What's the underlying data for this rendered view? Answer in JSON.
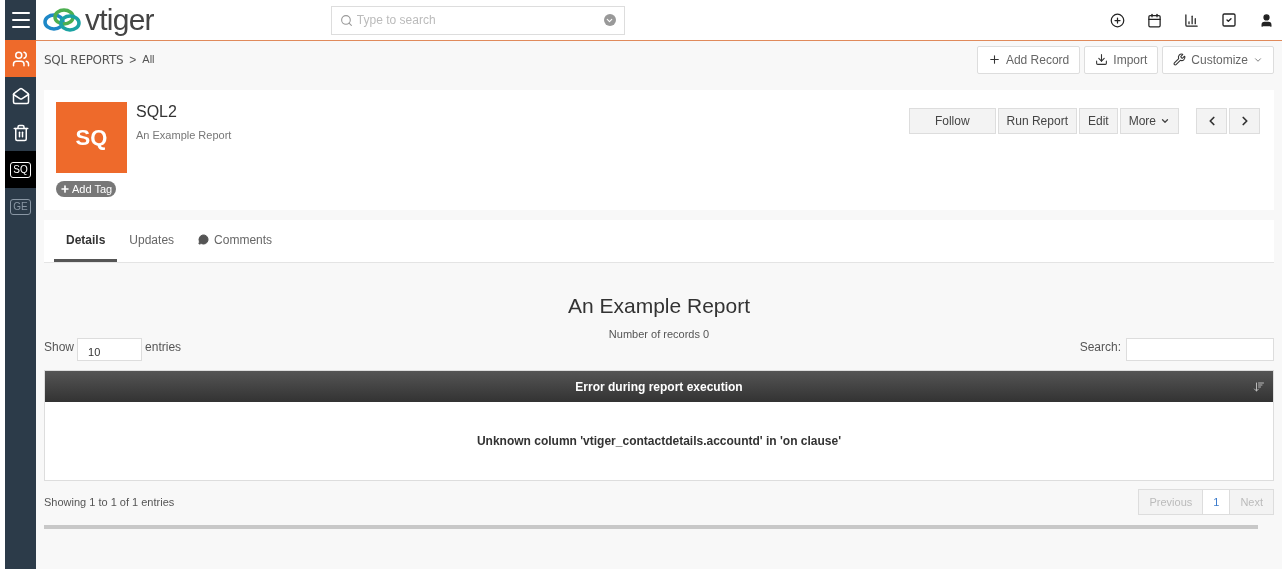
{
  "sidebar": {
    "items": [
      {
        "kind": "icon",
        "selected": true
      },
      {
        "kind": "icon",
        "selected": false
      },
      {
        "kind": "icon",
        "selected": false
      },
      {
        "kind": "badge",
        "label": "SQ",
        "selected": true
      },
      {
        "kind": "badge",
        "label": "GE",
        "selected": false
      }
    ]
  },
  "header": {
    "logo_text": "vtiger",
    "search": {
      "placeholder": "Type to search"
    }
  },
  "breadcrumb": {
    "module": "SQL REPORTS",
    "separator": ">",
    "view": "All"
  },
  "toolbar": {
    "buttons": [
      {
        "label": "Add Record",
        "kind": "add"
      },
      {
        "label": "Import",
        "kind": "import"
      },
      {
        "label": "Customize",
        "kind": "customize"
      }
    ]
  },
  "record": {
    "avatar": "SQ",
    "title": "SQL2",
    "subtitle": "An Example Report",
    "tag_button": "Add Tag",
    "actions": [
      {
        "label": "Follow",
        "dropdown": false
      },
      {
        "label": "Run Report",
        "dropdown": false
      },
      {
        "label": "Edit",
        "dropdown": false
      },
      {
        "label": "More",
        "dropdown": true
      }
    ]
  },
  "tabs": [
    {
      "label": "Details",
      "selected": true,
      "kind": "plain"
    },
    {
      "label": "Updates",
      "selected": false,
      "kind": "plain"
    },
    {
      "label": "Comments",
      "selected": false,
      "kind": "comment"
    }
  ],
  "report": {
    "title": "An Example Report",
    "record_count": "Number of records 0",
    "show_label": "Show",
    "page_size": "10",
    "entries_label": "entries",
    "search_label": "Search:",
    "column": "Error during report execution",
    "message": "Unknown column 'vtiger_contactdetails.accountd' in 'on clause'",
    "info": "Showing 1 to 1 of 1 entries",
    "pagination": [
      {
        "label": "Previous",
        "selected": false,
        "disabled": true
      },
      {
        "label": "1",
        "selected": true,
        "disabled": false
      },
      {
        "label": "Next",
        "selected": false,
        "disabled": true
      }
    ]
  }
}
